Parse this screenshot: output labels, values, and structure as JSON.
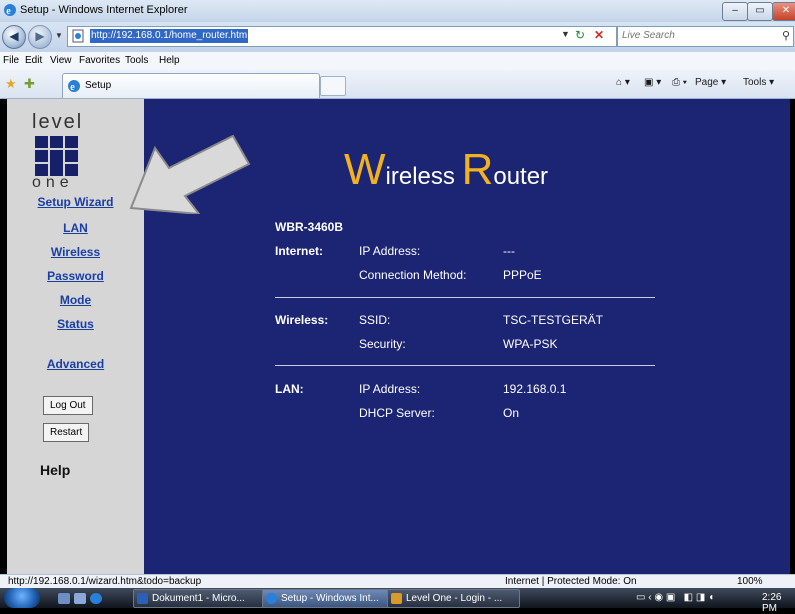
{
  "window": {
    "title": "Setup - Windows Internet Explorer",
    "minimize": "–",
    "maximize": "▭",
    "close": "✕"
  },
  "addressbar": {
    "url": "http://192.168.0.1/home_router.htm",
    "search_placeholder": "Live Search"
  },
  "menubar": [
    "File",
    "Edit",
    "View",
    "Favorites",
    "Tools",
    "Help"
  ],
  "tabs": {
    "active_label": "Setup"
  },
  "commandbar": {
    "page": "Page ▾",
    "tools": "Tools ▾"
  },
  "sidebar": {
    "logo_top": "level",
    "logo_bottom": "one",
    "links": [
      "Setup Wizard",
      "LAN",
      "Wireless",
      "Password",
      "Mode",
      "Status",
      "Advanced"
    ],
    "logout": "Log Out",
    "restart": "Restart",
    "help": "Help"
  },
  "router": {
    "title_w_big": "W",
    "title_w_rest": "ireless ",
    "title_r_big": "R",
    "title_r_rest": "outer",
    "model": "WBR-3460B",
    "internet": {
      "label": "Internet:",
      "ip_label": "IP Address:",
      "ip_value": "---",
      "method_label": "Connection Method:",
      "method_value": "PPPoE"
    },
    "wireless": {
      "label": "Wireless:",
      "ssid_label": "SSID:",
      "ssid_value": "TSC-TESTGERÄT",
      "security_label": "Security:",
      "security_value": "WPA-PSK"
    },
    "lan": {
      "label": "LAN:",
      "ip_label": "IP Address:",
      "ip_value": "192.168.0.1",
      "dhcp_label": "DHCP Server:",
      "dhcp_value": "On"
    }
  },
  "statusbar": {
    "url": "http://192.168.0.1/wizard.htm&todo=backup",
    "zone": "Internet | Protected Mode: On",
    "zoom": "100%"
  },
  "taskbar": {
    "items": [
      "Dokument1 - Micro...",
      "Setup - Windows Int...",
      "Level One - Login - ..."
    ],
    "clock": "2:26 PM"
  },
  "colors": {
    "router_bg": "#1c2474",
    "title_accent": "#f2b21d",
    "sidebar_bg": "#d6d6d6",
    "link": "#1a3ea6"
  }
}
